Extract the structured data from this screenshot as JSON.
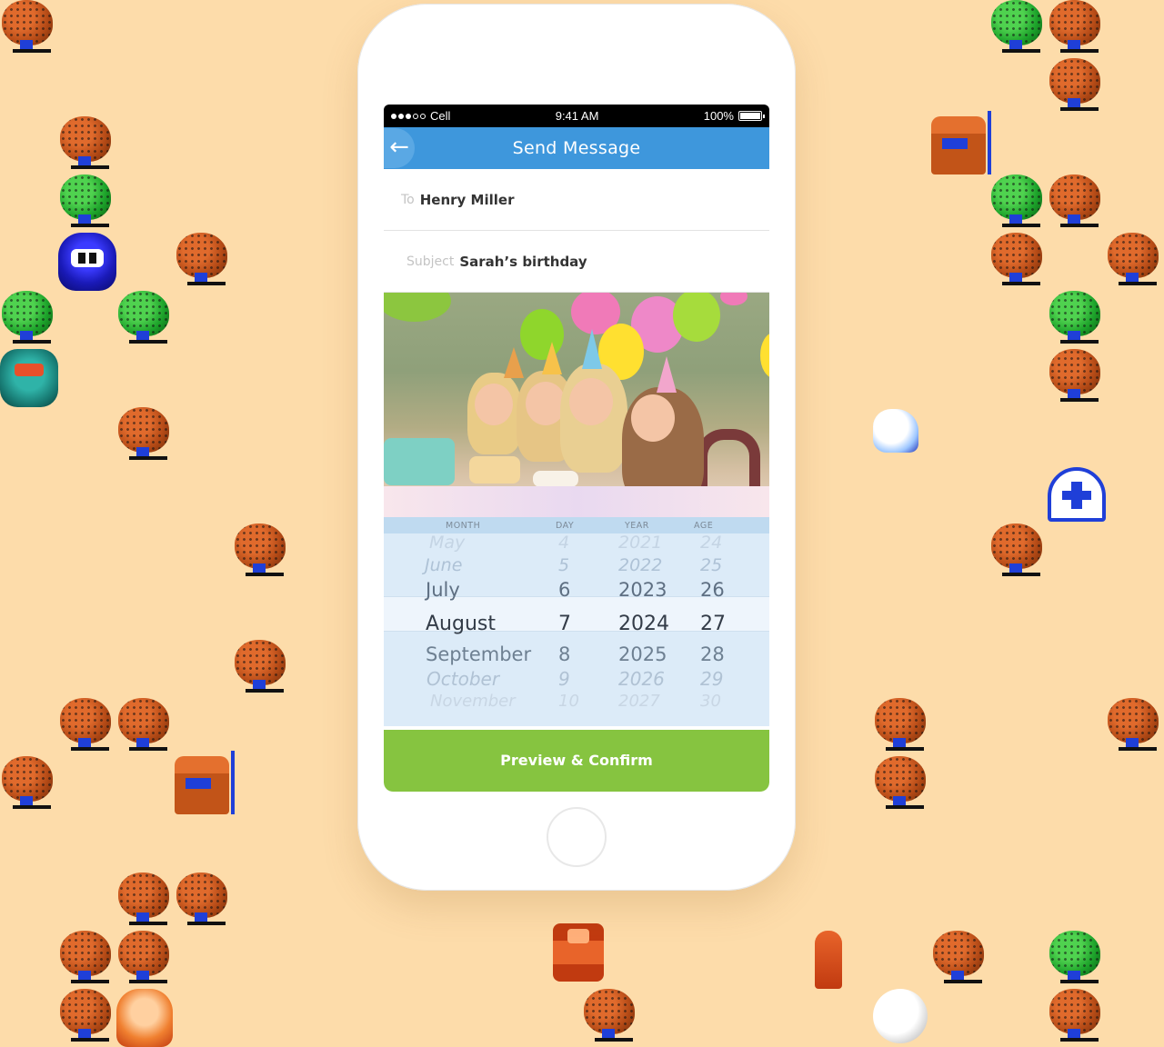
{
  "status_bar": {
    "carrier": "Cell",
    "time": "9:41 AM",
    "battery": "100%",
    "battery_level": 1.0
  },
  "nav": {
    "back_icon": "arrow-left-icon",
    "title": "Send Message"
  },
  "message": {
    "to_label": "To",
    "to_value": "Henry Miller",
    "subject_label": "Subject",
    "subject_value": "Sarah’s birthday"
  },
  "picker": {
    "headers": {
      "month": "MONTH",
      "day": "DAY",
      "year": "YEAR",
      "age": "AGE"
    },
    "rows": [
      {
        "month": "May",
        "day": "4",
        "year": "2021",
        "age": "24"
      },
      {
        "month": "June",
        "day": "5",
        "year": "2022",
        "age": "25"
      },
      {
        "month": "July",
        "day": "6",
        "year": "2023",
        "age": "26"
      },
      {
        "month": "August",
        "day": "7",
        "year": "2024",
        "age": "27"
      },
      {
        "month": "September",
        "day": "8",
        "year": "2025",
        "age": "28"
      },
      {
        "month": "October",
        "day": "9",
        "year": "2026",
        "age": "29"
      },
      {
        "month": "November",
        "day": "10",
        "year": "2027",
        "age": "30"
      }
    ],
    "selected_index": 3
  },
  "confirm_button": "Preview & Confirm",
  "colors": {
    "background": "#fddcaa",
    "nav_blue": "#3e97dc",
    "confirm_green": "#86c440",
    "picker_blue": "#dcebf8"
  }
}
